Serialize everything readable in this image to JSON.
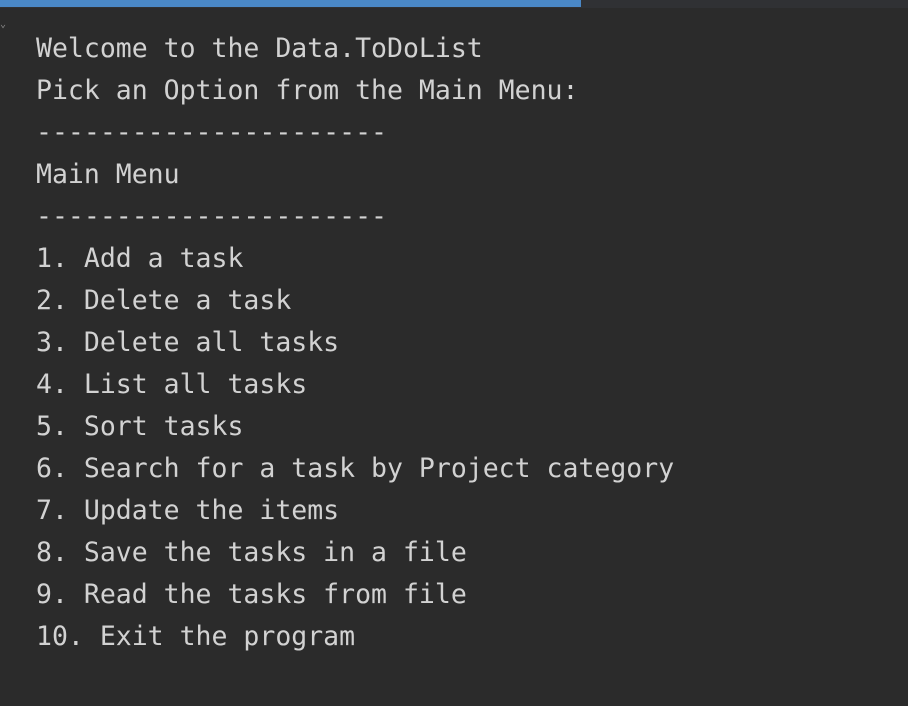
{
  "run_progress": 0.64,
  "gutter": {
    "fold_icon": "fold-arrow-icon"
  },
  "console": {
    "lines": [
      "Welcome to the Data.ToDoList",
      "Pick an Option from the Main Menu:",
      "----------------------",
      "Main Menu",
      "----------------------",
      "1. Add a task",
      "2. Delete a task",
      "3. Delete all tasks",
      "4. List all tasks",
      "5. Sort tasks",
      "6. Search for a task by Project category",
      "7. Update the items",
      "8. Save the tasks in a file",
      "9. Read the tasks from file",
      "10. Exit the program"
    ]
  },
  "colors": {
    "background": "#2b2b2b",
    "text": "#d2d2d2",
    "progress": "#4a88c7"
  }
}
